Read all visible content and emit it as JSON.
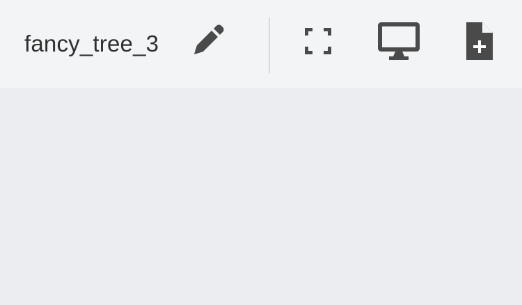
{
  "header": {
    "title": "fancy_tree_3"
  },
  "icons": {
    "edit": "pencil-icon",
    "fullscreen": "fullscreen-icon",
    "present": "monitor-icon",
    "new_file": "file-add-icon"
  },
  "colors": {
    "toolbar_bg": "#f3f4f6",
    "canvas_bg": "#ecedf1",
    "icon": "#4a4a4a",
    "text": "#2f2f2f",
    "divider": "#d9dbe0"
  }
}
